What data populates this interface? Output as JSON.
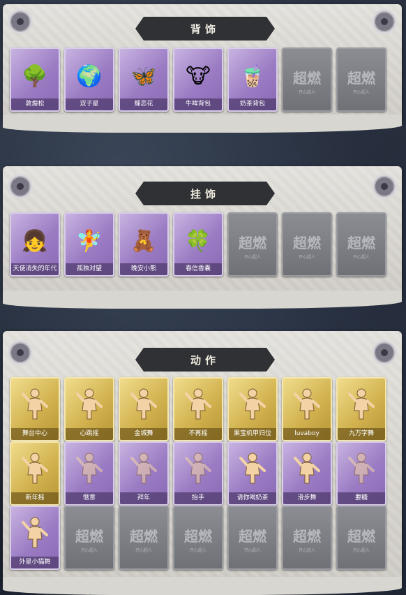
{
  "sections": [
    {
      "title": "背饰",
      "items": [
        {
          "label": "敦煌松",
          "kind": "purple",
          "icon": "bonsai-icon"
        },
        {
          "label": "双子星",
          "kind": "purple",
          "icon": "planet-prince-icon"
        },
        {
          "label": "蝶恋花",
          "kind": "purple",
          "icon": "butterfly-flower-icon"
        },
        {
          "label": "牛哞背包",
          "kind": "purple",
          "icon": "cow-backpack-icon"
        },
        {
          "label": "奶茶背包",
          "kind": "purple",
          "icon": "milk-tea-backpack-icon"
        },
        {
          "label": "",
          "kind": "empty",
          "icon": "empty-slot"
        },
        {
          "label": "",
          "kind": "empty",
          "icon": "empty-slot"
        }
      ]
    },
    {
      "title": "挂饰",
      "items": [
        {
          "label": "天使消失的年代",
          "kind": "purple",
          "icon": "angel-girl-icon"
        },
        {
          "label": "孤独对望",
          "kind": "purple",
          "icon": "lonely-gaze-charm-icon"
        },
        {
          "label": "晚安小熊",
          "kind": "purple",
          "icon": "bear-charm-icon"
        },
        {
          "label": "春信香囊",
          "kind": "purple",
          "icon": "sachet-icon"
        },
        {
          "label": "",
          "kind": "empty",
          "icon": "empty-slot"
        },
        {
          "label": "",
          "kind": "empty",
          "icon": "empty-slot"
        },
        {
          "label": "",
          "kind": "empty",
          "icon": "empty-slot"
        }
      ]
    },
    {
      "title": "动作",
      "items": [
        {
          "label": "舞台中心",
          "kind": "gold",
          "icon": "dance-pose-icon"
        },
        {
          "label": "心跳摇",
          "kind": "gold",
          "icon": "dance-pose-icon"
        },
        {
          "label": "金城舞",
          "kind": "gold",
          "icon": "dance-pose-icon"
        },
        {
          "label": "不再摇",
          "kind": "gold",
          "icon": "dance-pose-icon"
        },
        {
          "label": "果宝机甲归位",
          "kind": "gold",
          "icon": "dance-pose-icon"
        },
        {
          "label": "luvaboy",
          "kind": "gold",
          "icon": "dance-pose-icon"
        },
        {
          "label": "九万字舞",
          "kind": "gold",
          "icon": "dance-pose-icon"
        },
        {
          "label": "新年摇",
          "kind": "gold",
          "icon": "dance-pose-icon"
        },
        {
          "label": "惬意",
          "kind": "purple-ghost",
          "icon": "dance-pose-icon"
        },
        {
          "label": "拜年",
          "kind": "purple-ghost",
          "icon": "dance-pose-icon"
        },
        {
          "label": "抬手",
          "kind": "purple-ghost",
          "icon": "dance-pose-icon"
        },
        {
          "label": "请你喝奶茶",
          "kind": "purple",
          "icon": "dance-pose-icon"
        },
        {
          "label": "滑步舞",
          "kind": "purple",
          "icon": "dance-pose-icon"
        },
        {
          "label": "要糖",
          "kind": "purple-ghost",
          "icon": "dance-pose-icon"
        },
        {
          "label": "外星小猫舞",
          "kind": "purple",
          "icon": "dance-pose-icon"
        },
        {
          "label": "",
          "kind": "empty",
          "icon": "empty-slot"
        },
        {
          "label": "",
          "kind": "empty",
          "icon": "empty-slot"
        },
        {
          "label": "",
          "kind": "empty",
          "icon": "empty-slot"
        },
        {
          "label": "",
          "kind": "empty",
          "icon": "empty-slot"
        },
        {
          "label": "",
          "kind": "empty",
          "icon": "empty-slot"
        },
        {
          "label": "",
          "kind": "empty",
          "icon": "empty-slot"
        }
      ]
    }
  ],
  "watermark": {
    "main": "超燃",
    "sub": "开心超人"
  },
  "colors": {
    "purple": "#9b7cc4",
    "gold": "#d2b350",
    "empty": "#7c7e84",
    "banner": "#2f3134"
  }
}
